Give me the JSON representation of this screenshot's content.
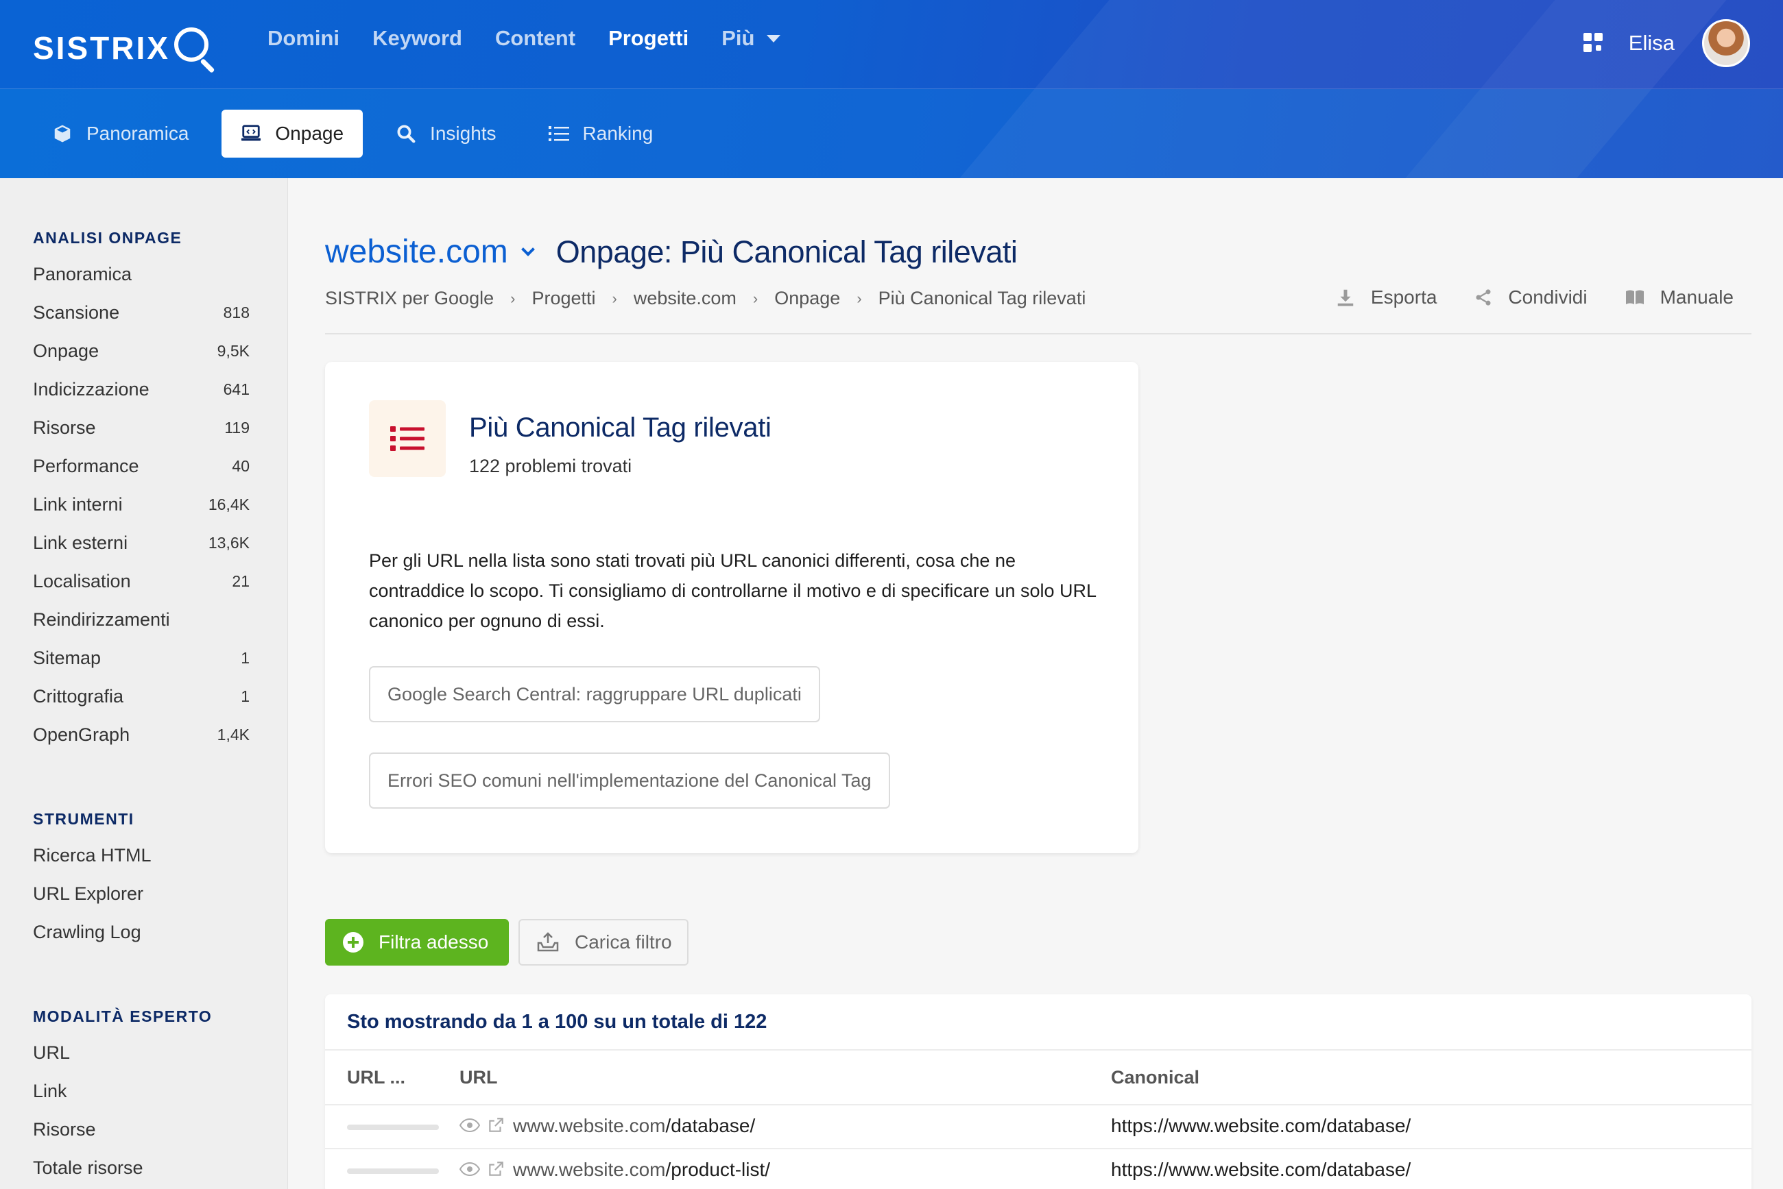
{
  "brand": {
    "logo_text": "SISTRIX"
  },
  "header": {
    "nav": [
      "Domini",
      "Keyword",
      "Content",
      "Progetti",
      "Più"
    ],
    "active_nav": "Progetti",
    "user_name": "Elisa"
  },
  "subnav": {
    "tabs": [
      {
        "label": "Panoramica",
        "icon": "cube-icon"
      },
      {
        "label": "Onpage",
        "icon": "laptop-code-icon"
      },
      {
        "label": "Insights",
        "icon": "search-icon"
      },
      {
        "label": "Ranking",
        "icon": "list-icon"
      }
    ],
    "active": "Onpage"
  },
  "sidebar": {
    "sections": [
      {
        "heading": "ANALISI ONPAGE",
        "items": [
          {
            "label": "Panoramica",
            "count": ""
          },
          {
            "label": "Scansione",
            "count": "818"
          },
          {
            "label": "Onpage",
            "count": "9,5K"
          },
          {
            "label": "Indicizzazione",
            "count": "641"
          },
          {
            "label": "Risorse",
            "count": "119"
          },
          {
            "label": "Performance",
            "count": "40"
          },
          {
            "label": "Link interni",
            "count": "16,4K"
          },
          {
            "label": "Link esterni",
            "count": "13,6K"
          },
          {
            "label": "Localisation",
            "count": "21"
          },
          {
            "label": "Reindirizzamenti",
            "count": ""
          },
          {
            "label": "Sitemap",
            "count": "1"
          },
          {
            "label": "Crittografia",
            "count": "1"
          },
          {
            "label": "OpenGraph",
            "count": "1,4K"
          }
        ]
      },
      {
        "heading": "STRUMENTI",
        "items": [
          {
            "label": "Ricerca HTML",
            "count": ""
          },
          {
            "label": "URL Explorer",
            "count": ""
          },
          {
            "label": "Crawling Log",
            "count": ""
          }
        ]
      },
      {
        "heading": "MODALITÀ ESPERTO",
        "items": [
          {
            "label": "URL",
            "count": ""
          },
          {
            "label": "Link",
            "count": ""
          },
          {
            "label": "Risorse",
            "count": ""
          },
          {
            "label": "Totale risorse",
            "count": ""
          }
        ]
      }
    ]
  },
  "page": {
    "domain": "website.com",
    "title": "Onpage: Più Canonical Tag rilevati",
    "breadcrumb": [
      "SISTRIX per Google",
      "Progetti",
      "website.com",
      "Onpage",
      "Più Canonical Tag rilevati"
    ],
    "actions": {
      "export": "Esporta",
      "share": "Condividi",
      "manual": "Manuale"
    }
  },
  "issue": {
    "title": "Più Canonical Tag rilevati",
    "subtitle": "122 problemi trovati",
    "description": "Per gli URL nella lista sono stati trovati più URL canonici differenti, cosa che ne contraddice lo scopo. Ti consigliamo di controllarne il motivo e di specificare un solo URL canonico per ognuno di essi.",
    "links": [
      "Google Search Central: raggruppare URL duplicati",
      "Errori SEO comuni nell'implementazione del Canonical Tag"
    ],
    "accent_color": "#c8102e"
  },
  "filters": {
    "apply": "Filtra adesso",
    "load": "Carica filtro"
  },
  "table": {
    "caption": "Sto mostrando da 1 a 100 su un totale di 122",
    "columns": [
      "URL ...",
      "URL",
      "Canonical"
    ],
    "rows": [
      {
        "host": "www.website.com",
        "path": "/database/",
        "canonical": "https://www.website.com/database/"
      },
      {
        "host": "www.website.com",
        "path": "/product-list/",
        "canonical": "https://www.website.com/database/"
      }
    ]
  },
  "colors": {
    "primary": "#0b5fd2",
    "navy": "#0d2a66",
    "green": "#5db41f"
  }
}
